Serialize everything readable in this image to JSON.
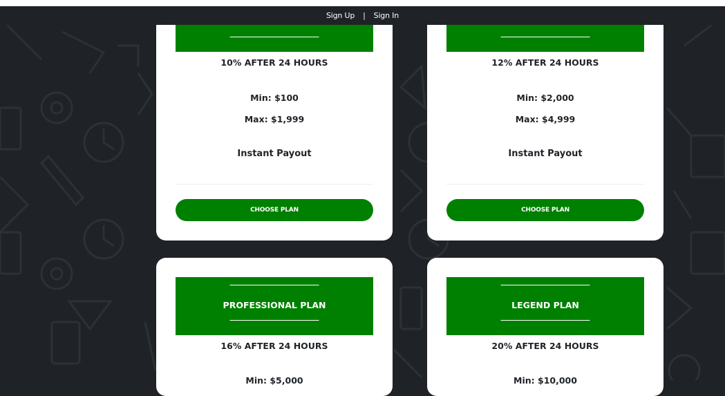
{
  "topbar": {
    "signup": "Sign Up",
    "separator": "|",
    "signin": "Sign In"
  },
  "colors": {
    "accent": "#008000",
    "background": "#1f2327",
    "card": "#ffffff"
  },
  "plans": [
    {
      "title": "",
      "rate": "10% AFTER 24 HOURS",
      "min": "Min: $100",
      "max": "Max: $1,999",
      "payout": "Instant Payout",
      "button": "CHOOSE PLAN"
    },
    {
      "title": "",
      "rate": "12% AFTER 24 HOURS",
      "min": "Min: $2,000",
      "max": "Max: $4,999",
      "payout": "Instant Payout",
      "button": "CHOOSE PLAN"
    },
    {
      "title": "PROFESSIONAL PLAN",
      "rate": "16% AFTER 24 HOURS",
      "min": "Min: $5,000"
    },
    {
      "title": "LEGEND PLAN",
      "rate": "20% AFTER 24 HOURS",
      "min": "Min: $10,000"
    }
  ]
}
